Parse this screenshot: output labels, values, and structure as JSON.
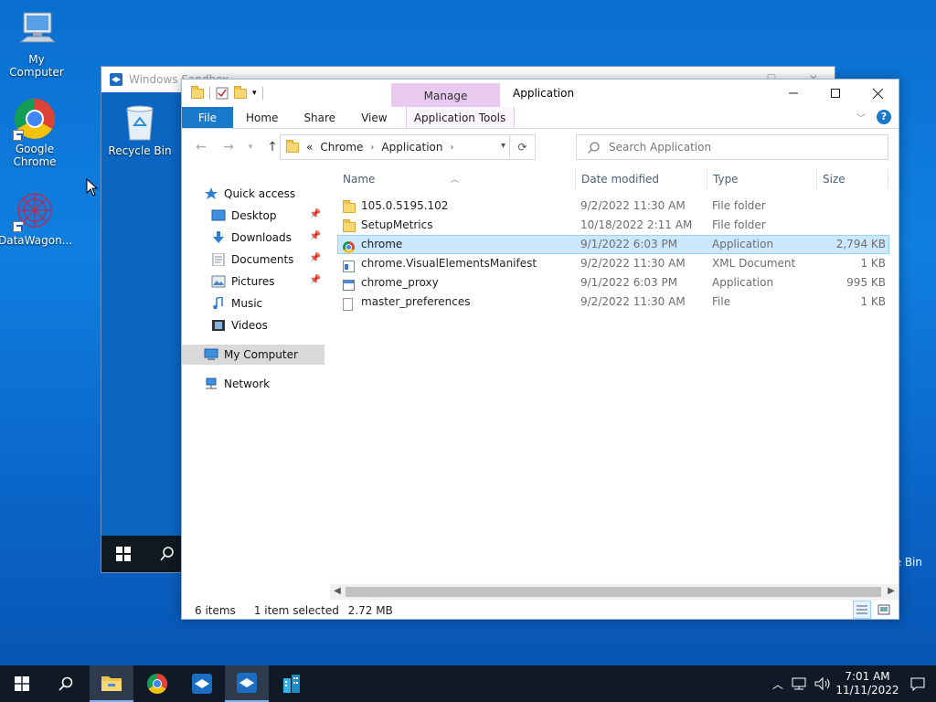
{
  "desktop": {
    "icons": [
      {
        "label": "My Computer",
        "icon": "computer-icon"
      },
      {
        "label": "Google Chrome",
        "icon": "chrome-icon"
      },
      {
        "label": "DataWagon...",
        "icon": "datawagon-icon"
      }
    ]
  },
  "sandbox": {
    "title": "Windows Sandbox",
    "recycle_label": "Recycle Bin",
    "recycle_label_partial": "e Bin"
  },
  "explorer": {
    "title": "Application",
    "manage_tab": "Manage",
    "ribbon_tabs": [
      "File",
      "Home",
      "Share",
      "View",
      "Application Tools"
    ],
    "address": {
      "prefix": "«",
      "crumbs": [
        "Chrome",
        "Application"
      ]
    },
    "search": {
      "placeholder": "Search Application"
    },
    "nav": [
      {
        "label": "Quick access",
        "icon": "star-icon"
      },
      {
        "label": "Desktop",
        "icon": "desktop-icon",
        "pinned": true
      },
      {
        "label": "Downloads",
        "icon": "download-icon",
        "pinned": true
      },
      {
        "label": "Documents",
        "icon": "documents-icon",
        "pinned": true
      },
      {
        "label": "Pictures",
        "icon": "pictures-icon",
        "pinned": true
      },
      {
        "label": "Music",
        "icon": "music-icon"
      },
      {
        "label": "Videos",
        "icon": "videos-icon"
      },
      {
        "label": "My Computer",
        "icon": "computer-icon",
        "selected": true
      },
      {
        "label": "Network",
        "icon": "network-icon"
      }
    ],
    "columns": [
      "Name",
      "Date modified",
      "Type",
      "Size"
    ],
    "files": [
      {
        "name": "105.0.5195.102",
        "date": "9/2/2022 11:30 AM",
        "type": "File folder",
        "size": "",
        "icon": "folder-icon"
      },
      {
        "name": "SetupMetrics",
        "date": "10/18/2022 2:11 AM",
        "type": "File folder",
        "size": "",
        "icon": "folder-icon"
      },
      {
        "name": "chrome",
        "date": "9/1/2022 6:03 PM",
        "type": "Application",
        "size": "2,794 KB",
        "icon": "chrome-icon",
        "selected": true
      },
      {
        "name": "chrome.VisualElementsManifest",
        "date": "9/2/2022 11:30 AM",
        "type": "XML Document",
        "size": "1 KB",
        "icon": "xml-file-icon"
      },
      {
        "name": "chrome_proxy",
        "date": "9/1/2022 6:03 PM",
        "type": "Application",
        "size": "995 KB",
        "icon": "app-icon"
      },
      {
        "name": "master_preferences",
        "date": "9/2/2022 11:30 AM",
        "type": "File",
        "size": "1 KB",
        "icon": "file-icon"
      }
    ],
    "status": {
      "count": "6 items",
      "selection": "1 item selected",
      "size": "2.72 MB"
    }
  },
  "taskbar": {
    "time": "7:01 AM",
    "date": "11/11/2022"
  },
  "colors": {
    "accent": "#1979ca",
    "manage_tab": "#e8c9f0",
    "selection": "#cce8ff"
  }
}
